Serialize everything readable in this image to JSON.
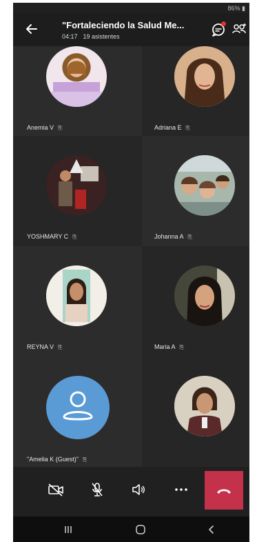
{
  "status_bar": {
    "battery": "86% ▮"
  },
  "header": {
    "title": "\"Fortaleciendo la Salud Me...",
    "time": "04:17",
    "attendees": "19 asistentes"
  },
  "participants": [
    {
      "name": "Anemia V",
      "pinned": true
    },
    {
      "name": "Adriana E",
      "pinned": true
    },
    {
      "name": "YOSHMARY C",
      "pinned": true
    },
    {
      "name": "Johanna A",
      "pinned": true
    },
    {
      "name": "REYNA V",
      "pinned": true
    },
    {
      "name": "Maria A",
      "pinned": true
    },
    {
      "name": "\"Amelia K (Guest)\"",
      "pinned": true
    },
    {
      "name": "",
      "pinned": false
    }
  ],
  "pin_glyph": "📌",
  "controls": [
    "camera-off-icon",
    "mic-off-icon",
    "speaker-icon",
    "more-icon",
    "hang-up-icon"
  ],
  "colors": {
    "hangup": "#c4314b",
    "generic_avatar": "#5b9bd5",
    "badge": "#e0312f"
  },
  "navbar": [
    "recents-icon",
    "home-icon",
    "back-icon"
  ]
}
